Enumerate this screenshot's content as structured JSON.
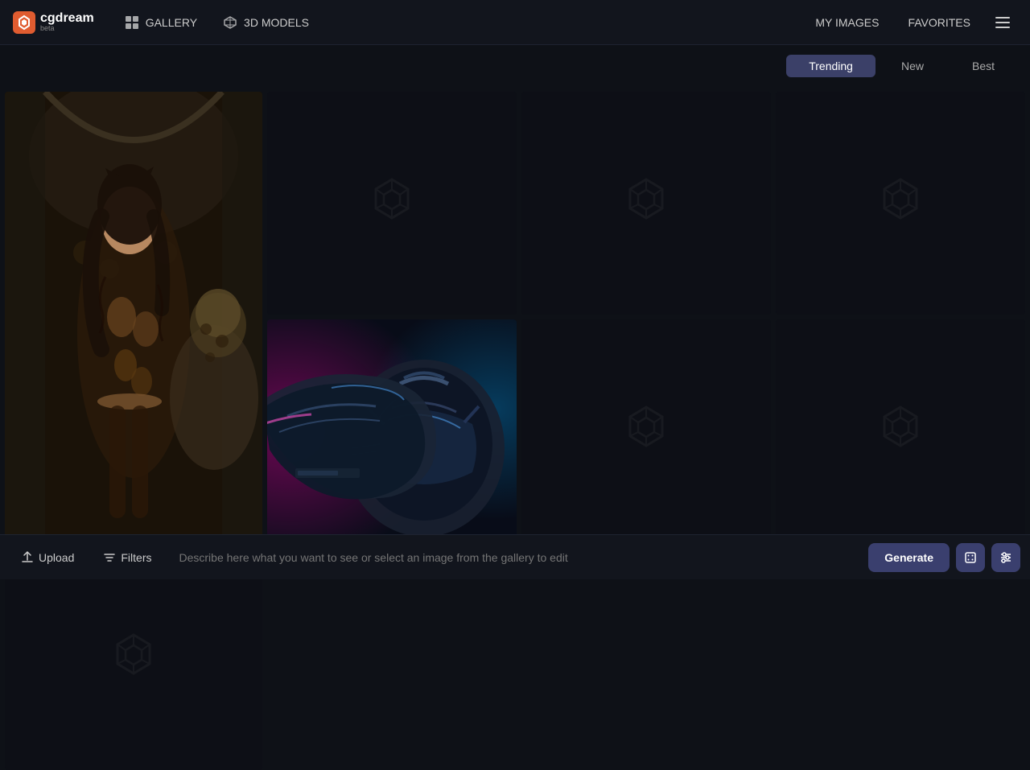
{
  "app": {
    "name": "cgdream",
    "beta_label": "beta",
    "logo_color": "#e05c30"
  },
  "nav": {
    "gallery_label": "GALLERY",
    "models_label": "3D MODELS",
    "my_images_label": "MY IMAGES",
    "favorites_label": "FAVORITES"
  },
  "filter_tabs": [
    {
      "id": "trending",
      "label": "Trending",
      "active": true
    },
    {
      "id": "new",
      "label": "New",
      "active": false
    },
    {
      "id": "best",
      "label": "Best",
      "active": false
    }
  ],
  "bottom_bar": {
    "upload_label": "Upload",
    "filters_label": "Filters",
    "prompt_placeholder": "Describe here what you want to see or select an image from the gallery to edit",
    "generate_label": "Generate"
  },
  "gallery": {
    "cells": [
      {
        "id": "cell-1",
        "type": "tall",
        "has_image": true,
        "row": 1,
        "col": 1
      },
      {
        "id": "cell-2",
        "type": "normal",
        "has_image": false,
        "row": 1,
        "col": 2
      },
      {
        "id": "cell-3",
        "type": "normal",
        "has_image": false,
        "row": 1,
        "col": 3
      },
      {
        "id": "cell-4",
        "type": "normal",
        "has_image": false,
        "row": 1,
        "col": 4
      },
      {
        "id": "cell-5",
        "type": "normal",
        "has_image": true,
        "row": 2,
        "col": 1
      },
      {
        "id": "cell-6",
        "type": "normal",
        "has_image": false,
        "row": 2,
        "col": 2
      },
      {
        "id": "cell-7",
        "type": "normal",
        "has_image": false,
        "row": 2,
        "col": 3
      },
      {
        "id": "cell-8",
        "type": "normal",
        "has_image": false,
        "row": 2,
        "col": 4
      }
    ]
  }
}
